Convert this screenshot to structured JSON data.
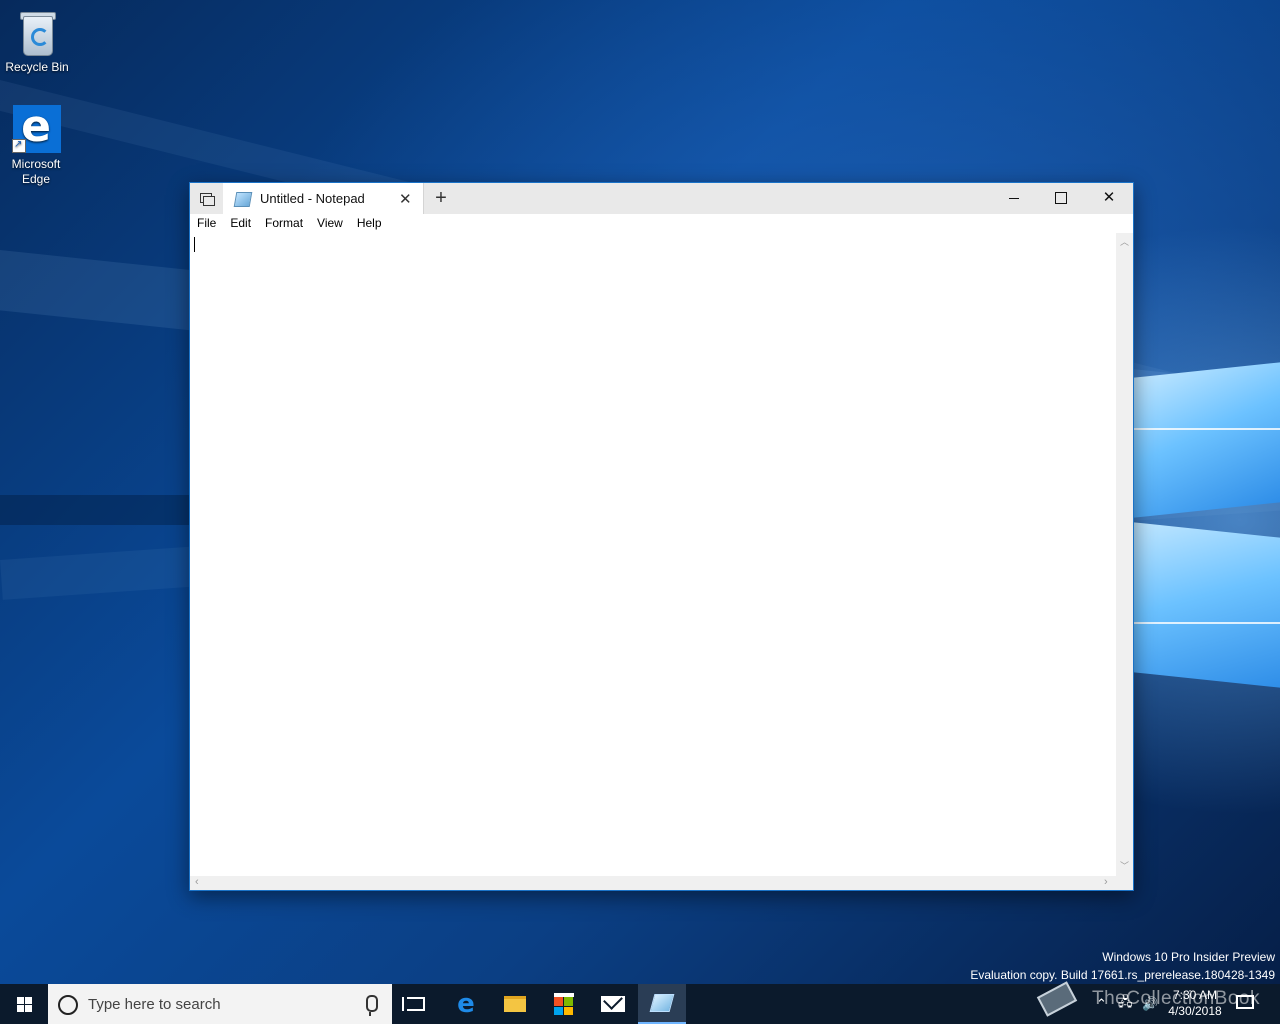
{
  "desktop": {
    "icons": [
      {
        "label": "Recycle Bin",
        "icon": "recycle-bin-icon"
      },
      {
        "label": "Microsoft Edge",
        "icon": "edge-icon"
      }
    ]
  },
  "window": {
    "tab_title": "Untitled - Notepad",
    "menu": [
      "File",
      "Edit",
      "Format",
      "View",
      "Help"
    ],
    "content": "",
    "accent_color": "#1a73c8"
  },
  "watermark": {
    "line1": "Windows 10 Pro Insider Preview",
    "line2": "Evaluation copy. Build 17661.rs_prerelease.180428-1349"
  },
  "taskbar": {
    "search_placeholder": "Type here to search",
    "time": "7:30 AM",
    "date": "4/30/2018",
    "pinned": [
      "task-view-icon",
      "edge-icon",
      "file-explorer-icon",
      "store-icon",
      "mail-icon",
      "notepad-icon"
    ]
  },
  "overlay_brand": {
    "text": "TheCollectionBook"
  }
}
